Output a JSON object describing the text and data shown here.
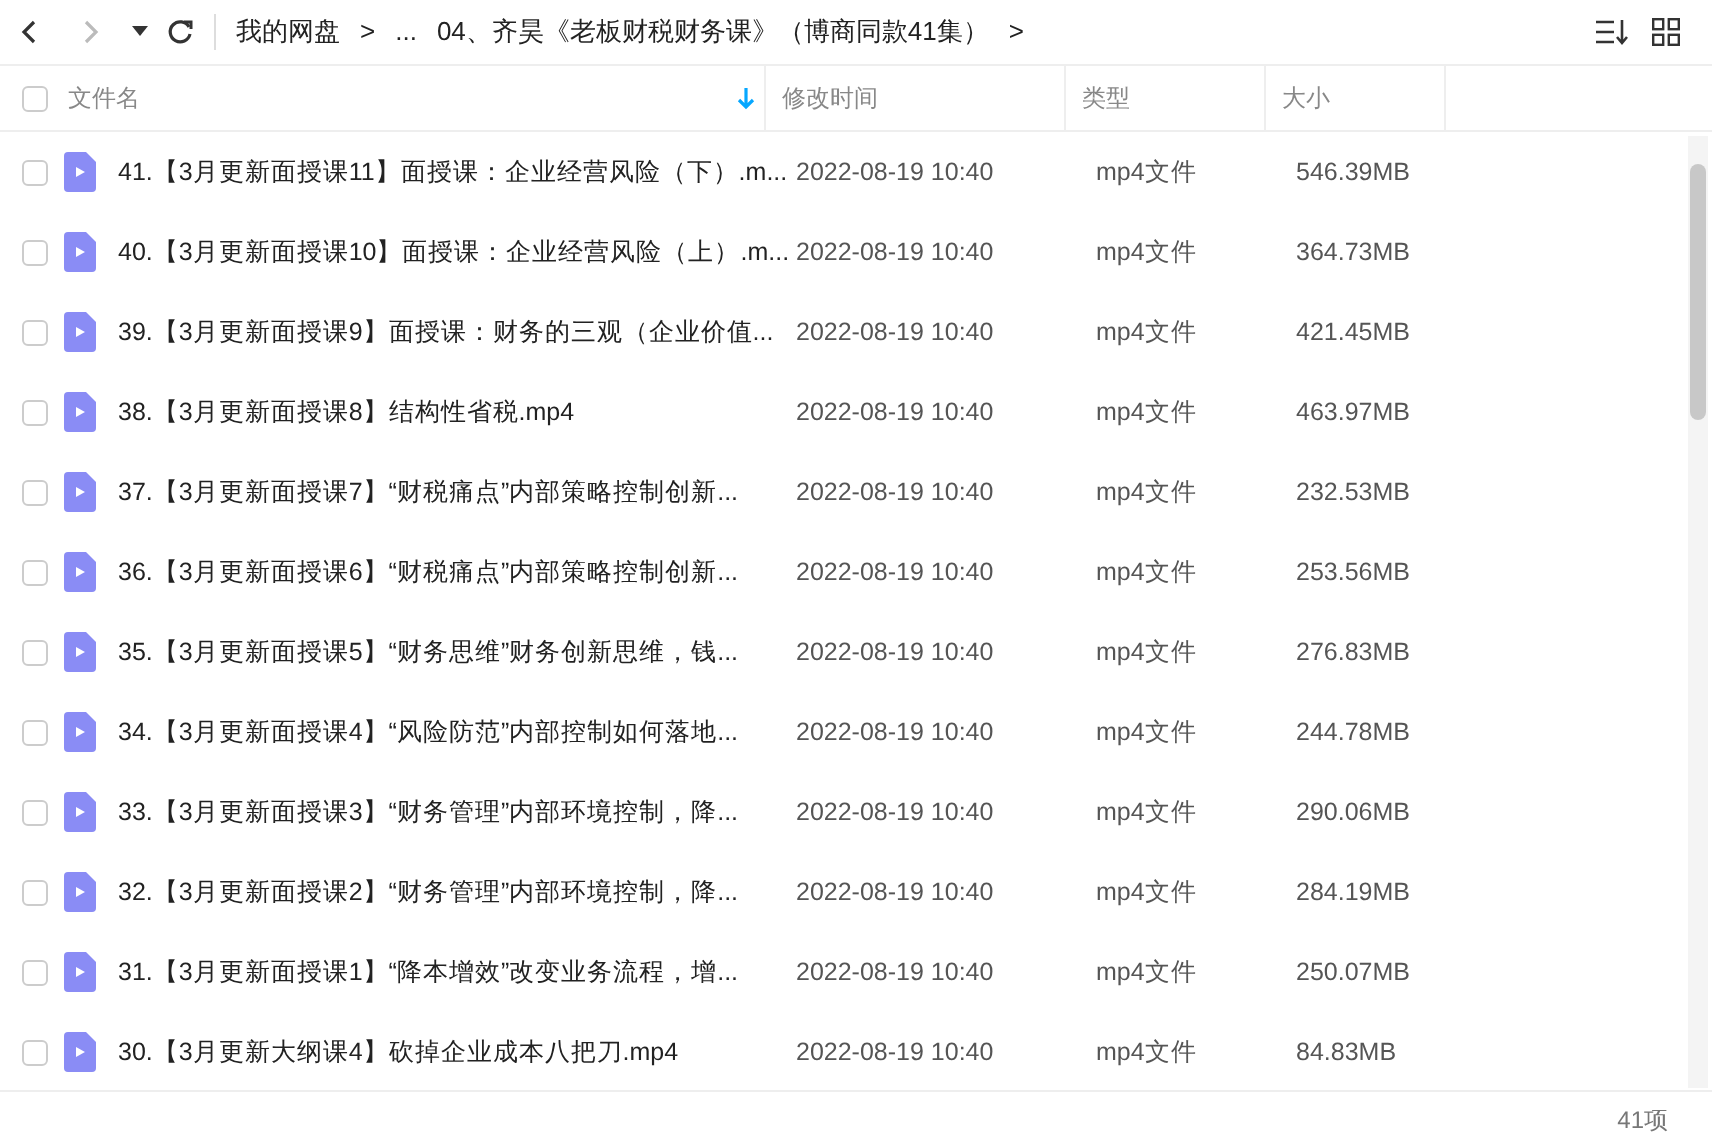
{
  "toolbar": {
    "breadcrumb": [
      "我的网盘",
      ">",
      "...",
      "04、齐昊《老板财税财务课》（博商同款41集）",
      ">"
    ]
  },
  "table": {
    "select_all": {
      "checked": false
    },
    "columns": [
      "文件名",
      "修改时间",
      "类型",
      "大小"
    ],
    "rows": [
      {
        "checked": false,
        "name": "41.【3月更新面授课11】面授课：企业经营风险（下）.m...",
        "modified": "2022-08-19 10:40",
        "type": "mp4文件",
        "size": "546.39MB"
      },
      {
        "checked": false,
        "name": "40.【3月更新面授课10】面授课：企业经营风险（上）.m...",
        "modified": "2022-08-19 10:40",
        "type": "mp4文件",
        "size": "364.73MB"
      },
      {
        "checked": false,
        "name": "39.【3月更新面授课9】面授课：财务的三观（企业价值...",
        "modified": "2022-08-19 10:40",
        "type": "mp4文件",
        "size": "421.45MB"
      },
      {
        "checked": false,
        "name": "38.【3月更新面授课8】结构性省税.mp4",
        "modified": "2022-08-19 10:40",
        "type": "mp4文件",
        "size": "463.97MB"
      },
      {
        "checked": false,
        "name": "37.【3月更新面授课7】“财税痛点”内部策略控制创新...",
        "modified": "2022-08-19 10:40",
        "type": "mp4文件",
        "size": "232.53MB"
      },
      {
        "checked": false,
        "name": "36.【3月更新面授课6】“财税痛点”内部策略控制创新...",
        "modified": "2022-08-19 10:40",
        "type": "mp4文件",
        "size": "253.56MB"
      },
      {
        "checked": false,
        "name": "35.【3月更新面授课5】“财务思维”财务创新思维，钱...",
        "modified": "2022-08-19 10:40",
        "type": "mp4文件",
        "size": "276.83MB"
      },
      {
        "checked": false,
        "name": "34.【3月更新面授课4】“风险防范”内部控制如何落地...",
        "modified": "2022-08-19 10:40",
        "type": "mp4文件",
        "size": "244.78MB"
      },
      {
        "checked": false,
        "name": "33.【3月更新面授课3】“财务管理”内部环境控制，降...",
        "modified": "2022-08-19 10:40",
        "type": "mp4文件",
        "size": "290.06MB"
      },
      {
        "checked": false,
        "name": "32.【3月更新面授课2】“财务管理”内部环境控制，降...",
        "modified": "2022-08-19 10:40",
        "type": "mp4文件",
        "size": "284.19MB"
      },
      {
        "checked": false,
        "name": "31.【3月更新面授课1】“降本增效”改变业务流程，增...",
        "modified": "2022-08-19 10:40",
        "type": "mp4文件",
        "size": "250.07MB"
      },
      {
        "checked": false,
        "name": "30.【3月更新大纲课4】砍掉企业成本八把刀.mp4",
        "modified": "2022-08-19 10:40",
        "type": "mp4文件",
        "size": "84.83MB"
      }
    ]
  },
  "status_bar": {
    "count": "41项"
  }
}
